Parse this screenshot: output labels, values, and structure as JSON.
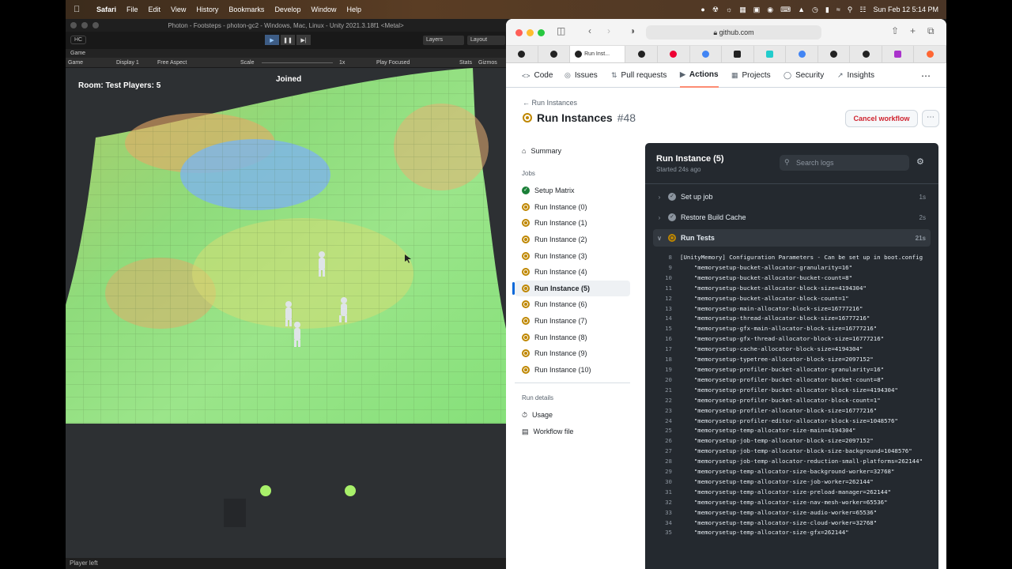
{
  "mac_menubar": {
    "app": "Safari",
    "items": [
      "File",
      "Edit",
      "View",
      "History",
      "Bookmarks",
      "Develop",
      "Window",
      "Help"
    ],
    "clock": "Sun Feb 12  5:14 PM"
  },
  "unity": {
    "window_title": "Photon - Footsteps - photon-gc2 - Windows, Mac, Linux - Unity 2021.3.18f1 <Metal>",
    "account": "HC",
    "layers_label": "Layers",
    "layout_label": "Layout",
    "tab_label": "Game",
    "gamebar": {
      "mode": "Game",
      "display": "Display 1",
      "aspect": "Free Aspect",
      "scale_label": "Scale",
      "scale_value": "1x",
      "play_focused": "Play Focused",
      "stats": "Stats",
      "gizmos": "Gizmos"
    },
    "hud": {
      "room": "Room: Test Players: 5",
      "status": "Joined"
    },
    "statusbar": "Player left"
  },
  "safari": {
    "url": "github.com",
    "active_tab": "Run Inst..."
  },
  "github": {
    "nav": [
      "Code",
      "Issues",
      "Pull requests",
      "Actions",
      "Projects",
      "Security",
      "Insights"
    ],
    "active_nav": "Actions",
    "breadcrumb": "Run Instances",
    "title": "Run Instances",
    "run_number": "#48",
    "cancel_label": "Cancel workflow",
    "sidebar": {
      "summary": "Summary",
      "jobs_heading": "Jobs",
      "jobs": [
        {
          "label": "Setup Matrix",
          "state": "success"
        },
        {
          "label": "Run Instance (0)",
          "state": "running"
        },
        {
          "label": "Run Instance (1)",
          "state": "running"
        },
        {
          "label": "Run Instance (2)",
          "state": "running"
        },
        {
          "label": "Run Instance (3)",
          "state": "running"
        },
        {
          "label": "Run Instance (4)",
          "state": "running"
        },
        {
          "label": "Run Instance (5)",
          "state": "running"
        },
        {
          "label": "Run Instance (6)",
          "state": "running"
        },
        {
          "label": "Run Instance (7)",
          "state": "running"
        },
        {
          "label": "Run Instance (8)",
          "state": "running"
        },
        {
          "label": "Run Instance (9)",
          "state": "running"
        },
        {
          "label": "Run Instance (10)",
          "state": "running"
        }
      ],
      "selected_job": "Run Instance (5)",
      "details_heading": "Run details",
      "usage": "Usage",
      "workflow_file": "Workflow file"
    },
    "logs": {
      "title": "Run Instance (5)",
      "started": "Started 24s ago",
      "search_placeholder": "Search logs",
      "steps": [
        {
          "label": "Set up job",
          "duration": "1s",
          "state": "success"
        },
        {
          "label": "Restore Build Cache",
          "duration": "2s",
          "state": "success"
        },
        {
          "label": "Run Tests",
          "duration": "21s",
          "state": "running"
        }
      ],
      "lines": [
        {
          "n": "8",
          "t": "[UnityMemory] Configuration Parameters - Can be set up in boot.config"
        },
        {
          "n": "9",
          "t": "    \"memorysetup-bucket-allocator-granularity=16\""
        },
        {
          "n": "10",
          "t": "    \"memorysetup-bucket-allocator-bucket-count=8\""
        },
        {
          "n": "11",
          "t": "    \"memorysetup-bucket-allocator-block-size=4194304\""
        },
        {
          "n": "12",
          "t": "    \"memorysetup-bucket-allocator-block-count=1\""
        },
        {
          "n": "13",
          "t": "    \"memorysetup-main-allocator-block-size=16777216\""
        },
        {
          "n": "14",
          "t": "    \"memorysetup-thread-allocator-block-size=16777216\""
        },
        {
          "n": "15",
          "t": "    \"memorysetup-gfx-main-allocator-block-size=16777216\""
        },
        {
          "n": "16",
          "t": "    \"memorysetup-gfx-thread-allocator-block-size=16777216\""
        },
        {
          "n": "17",
          "t": "    \"memorysetup-cache-allocator-block-size=4194304\""
        },
        {
          "n": "18",
          "t": "    \"memorysetup-typetree-allocator-block-size=2097152\""
        },
        {
          "n": "19",
          "t": "    \"memorysetup-profiler-bucket-allocator-granularity=16\""
        },
        {
          "n": "20",
          "t": "    \"memorysetup-profiler-bucket-allocator-bucket-count=8\""
        },
        {
          "n": "21",
          "t": "    \"memorysetup-profiler-bucket-allocator-block-size=4194304\""
        },
        {
          "n": "22",
          "t": "    \"memorysetup-profiler-bucket-allocator-block-count=1\""
        },
        {
          "n": "23",
          "t": "    \"memorysetup-profiler-allocator-block-size=16777216\""
        },
        {
          "n": "24",
          "t": "    \"memorysetup-profiler-editor-allocator-block-size=1048576\""
        },
        {
          "n": "25",
          "t": "    \"memorysetup-temp-allocator-size-main=4194304\""
        },
        {
          "n": "26",
          "t": "    \"memorysetup-job-temp-allocator-block-size=2097152\""
        },
        {
          "n": "27",
          "t": "    \"memorysetup-job-temp-allocator-block-size-background=1048576\""
        },
        {
          "n": "28",
          "t": "    \"memorysetup-job-temp-allocator-reduction-small-platforms=262144\""
        },
        {
          "n": "29",
          "t": "    \"memorysetup-temp-allocator-size-background-worker=32768\""
        },
        {
          "n": "30",
          "t": "    \"memorysetup-temp-allocator-size-job-worker=262144\""
        },
        {
          "n": "31",
          "t": "    \"memorysetup-temp-allocator-size-preload-manager=262144\""
        },
        {
          "n": "32",
          "t": "    \"memorysetup-temp-allocator-size-nav-mesh-worker=65536\""
        },
        {
          "n": "33",
          "t": "    \"memorysetup-temp-allocator-size-audio-worker=65536\""
        },
        {
          "n": "34",
          "t": "    \"memorysetup-temp-allocator-size-cloud-worker=32768\""
        },
        {
          "n": "35",
          "t": "    \"memorysetup-temp-allocator-size-gfx=262144\""
        }
      ]
    }
  }
}
